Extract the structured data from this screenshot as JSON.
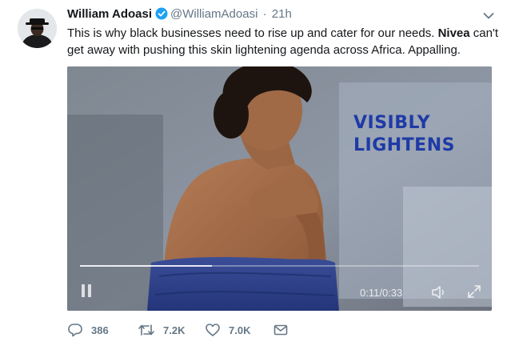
{
  "tweet": {
    "author_name": "William Adoasi",
    "handle": "@WilliamAdoasi",
    "separator": "·",
    "time": "21h",
    "text_part1": "This is why black businesses need to rise up and cater for our needs. ",
    "text_bold": "Nivea",
    "text_part2": " can't get away with pushing this skin lightening agenda across Africa. Appalling."
  },
  "video": {
    "overlay_line1": "VISIBLY",
    "overlay_line2": "LIGHTENS",
    "current_time": "0:11",
    "duration_separator": "/",
    "duration": "0:33",
    "progress": 0.33
  },
  "actions": {
    "replies": "386",
    "retweets": "7.2K",
    "likes": "7.0K"
  },
  "colors": {
    "verified": "#1da1f2",
    "overlay_text": "#1f3aa6",
    "secondary_text": "#657786"
  },
  "icons": [
    "caret-down-icon",
    "verified-icon",
    "pause-icon",
    "volume-icon",
    "fullscreen-icon",
    "reply-icon",
    "retweet-icon",
    "like-icon",
    "direct-message-icon"
  ]
}
